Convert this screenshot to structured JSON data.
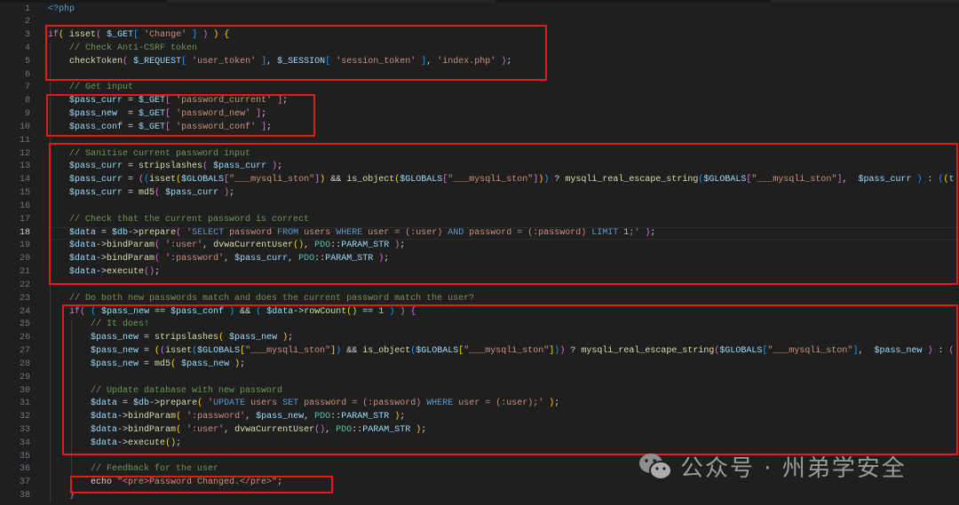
{
  "editor": {
    "current_line": 18,
    "lines": [
      [
        [
          "tag",
          "<?php"
        ]
      ],
      [],
      [
        [
          "k",
          "if"
        ],
        [
          "b1",
          "("
        ],
        [
          "p",
          " "
        ],
        [
          "f",
          "isset"
        ],
        [
          "b2",
          "("
        ],
        [
          "p",
          " "
        ],
        [
          "v",
          "$_GET"
        ],
        [
          "b3",
          "["
        ],
        [
          "p",
          " "
        ],
        [
          "s",
          "'Change'"
        ],
        [
          "p",
          " "
        ],
        [
          "b3",
          "]"
        ],
        [
          "p",
          " "
        ],
        [
          "b2",
          ")"
        ],
        [
          "p",
          " "
        ],
        [
          "b1",
          ")"
        ],
        [
          "p",
          " "
        ],
        [
          "b1",
          "{"
        ]
      ],
      [
        [
          "p",
          "    "
        ],
        [
          "c",
          "// Check Anti-CSRF token"
        ]
      ],
      [
        [
          "p",
          "    "
        ],
        [
          "f",
          "checkToken"
        ],
        [
          "b2",
          "("
        ],
        [
          "p",
          " "
        ],
        [
          "v",
          "$_REQUEST"
        ],
        [
          "b3",
          "["
        ],
        [
          "p",
          " "
        ],
        [
          "s",
          "'user_token'"
        ],
        [
          "p",
          " "
        ],
        [
          "b3",
          "]"
        ],
        [
          "p",
          ", "
        ],
        [
          "v",
          "$_SESSION"
        ],
        [
          "b3",
          "["
        ],
        [
          "p",
          " "
        ],
        [
          "s",
          "'session_token'"
        ],
        [
          "p",
          " "
        ],
        [
          "b3",
          "]"
        ],
        [
          "p",
          ", "
        ],
        [
          "s",
          "'index.php'"
        ],
        [
          "p",
          " "
        ],
        [
          "b2",
          ")"
        ],
        [
          "p",
          ";"
        ]
      ],
      [],
      [
        [
          "p",
          "    "
        ],
        [
          "c",
          "// Get input"
        ]
      ],
      [
        [
          "p",
          "    "
        ],
        [
          "v",
          "$pass_curr"
        ],
        [
          "p",
          " = "
        ],
        [
          "v",
          "$_GET"
        ],
        [
          "b2",
          "["
        ],
        [
          "p",
          " "
        ],
        [
          "s",
          "'password_current'"
        ],
        [
          "p",
          " "
        ],
        [
          "b2",
          "]"
        ],
        [
          "p",
          ";"
        ]
      ],
      [
        [
          "p",
          "    "
        ],
        [
          "v",
          "$pass_new"
        ],
        [
          "p",
          "  = "
        ],
        [
          "v",
          "$_GET"
        ],
        [
          "b2",
          "["
        ],
        [
          "p",
          " "
        ],
        [
          "s",
          "'password_new'"
        ],
        [
          "p",
          " "
        ],
        [
          "b2",
          "]"
        ],
        [
          "p",
          ";"
        ]
      ],
      [
        [
          "p",
          "    "
        ],
        [
          "v",
          "$pass_conf"
        ],
        [
          "p",
          " = "
        ],
        [
          "v",
          "$_GET"
        ],
        [
          "b2",
          "["
        ],
        [
          "p",
          " "
        ],
        [
          "s",
          "'password_conf'"
        ],
        [
          "p",
          " "
        ],
        [
          "b2",
          "]"
        ],
        [
          "p",
          ";"
        ]
      ],
      [],
      [
        [
          "p",
          "    "
        ],
        [
          "c",
          "// Sanitise current password input"
        ]
      ],
      [
        [
          "p",
          "    "
        ],
        [
          "v",
          "$pass_curr"
        ],
        [
          "p",
          " = "
        ],
        [
          "f",
          "stripslashes"
        ],
        [
          "b2",
          "("
        ],
        [
          "p",
          " "
        ],
        [
          "v",
          "$pass_curr"
        ],
        [
          "p",
          " "
        ],
        [
          "b2",
          ")"
        ],
        [
          "p",
          ";"
        ]
      ],
      [
        [
          "p",
          "    "
        ],
        [
          "v",
          "$pass_curr"
        ],
        [
          "p",
          " = "
        ],
        [
          "b2",
          "("
        ],
        [
          "b3",
          "("
        ],
        [
          "f",
          "isset"
        ],
        [
          "b1",
          "("
        ],
        [
          "v",
          "$GLOBALS"
        ],
        [
          "b2",
          "["
        ],
        [
          "s",
          "\"___mysqli_ston\""
        ],
        [
          "b2",
          "]"
        ],
        [
          "b1",
          ")"
        ],
        [
          "p",
          " && "
        ],
        [
          "f",
          "is_object"
        ],
        [
          "b1",
          "("
        ],
        [
          "v",
          "$GLOBALS"
        ],
        [
          "b2",
          "["
        ],
        [
          "s",
          "\"___mysqli_ston\""
        ],
        [
          "b2",
          "]"
        ],
        [
          "b1",
          ")"
        ],
        [
          "b3",
          ")"
        ],
        [
          "p",
          " ? "
        ],
        [
          "f",
          "mysqli_real_escape_string"
        ],
        [
          "b3",
          "("
        ],
        [
          "v",
          "$GLOBALS"
        ],
        [
          "b2",
          "["
        ],
        [
          "s",
          "\"___mysqli_ston\""
        ],
        [
          "b2",
          "]"
        ],
        [
          "p",
          ",  "
        ],
        [
          "v",
          "$pass_curr"
        ],
        [
          "p",
          " "
        ],
        [
          "b3",
          ")"
        ],
        [
          "p",
          " : "
        ],
        [
          "b3",
          "("
        ],
        [
          "b1",
          "("
        ],
        [
          "v",
          "t"
        ]
      ],
      [
        [
          "p",
          "    "
        ],
        [
          "v",
          "$pass_curr"
        ],
        [
          "p",
          " = "
        ],
        [
          "f",
          "md5"
        ],
        [
          "b2",
          "("
        ],
        [
          "p",
          " "
        ],
        [
          "v",
          "$pass_curr"
        ],
        [
          "p",
          " "
        ],
        [
          "b2",
          ")"
        ],
        [
          "p",
          ";"
        ]
      ],
      [],
      [
        [
          "p",
          "    "
        ],
        [
          "c",
          "// Check that the current password is correct"
        ]
      ],
      [
        [
          "p",
          "    "
        ],
        [
          "v",
          "$data"
        ],
        [
          "p",
          " = "
        ],
        [
          "v",
          "$db"
        ],
        [
          "p",
          "->"
        ],
        [
          "f",
          "prepare"
        ],
        [
          "b2",
          "("
        ],
        [
          "p",
          " "
        ],
        [
          "s",
          "'"
        ],
        [
          "q",
          "SELECT"
        ],
        [
          "s",
          " password "
        ],
        [
          "q",
          "FROM"
        ],
        [
          "s",
          " users "
        ],
        [
          "q",
          "WHERE"
        ],
        [
          "s",
          " user = (:user) "
        ],
        [
          "q",
          "AND"
        ],
        [
          "s",
          " password = (:password) "
        ],
        [
          "q",
          "LIMIT"
        ],
        [
          "n",
          " 1"
        ],
        [
          "s",
          ";'"
        ],
        [
          "p",
          " "
        ],
        [
          "b2",
          ")"
        ],
        [
          "p",
          ";"
        ]
      ],
      [
        [
          "p",
          "    "
        ],
        [
          "v",
          "$data"
        ],
        [
          "p",
          "->"
        ],
        [
          "f",
          "bindParam"
        ],
        [
          "b2",
          "("
        ],
        [
          "p",
          " "
        ],
        [
          "s",
          "':user'"
        ],
        [
          "p",
          ", "
        ],
        [
          "f",
          "dvwaCurrentUser"
        ],
        [
          "b1",
          "()"
        ],
        [
          "p",
          ", "
        ],
        [
          "t",
          "PDO"
        ],
        [
          "p",
          "::"
        ],
        [
          "v",
          "PARAM_STR"
        ],
        [
          "p",
          " "
        ],
        [
          "b2",
          ")"
        ],
        [
          "p",
          ";"
        ]
      ],
      [
        [
          "p",
          "    "
        ],
        [
          "v",
          "$data"
        ],
        [
          "p",
          "->"
        ],
        [
          "f",
          "bindParam"
        ],
        [
          "b2",
          "("
        ],
        [
          "p",
          " "
        ],
        [
          "s",
          "':password'"
        ],
        [
          "p",
          ", "
        ],
        [
          "v",
          "$pass_curr"
        ],
        [
          "p",
          ", "
        ],
        [
          "t",
          "PDO"
        ],
        [
          "p",
          "::"
        ],
        [
          "v",
          "PARAM_STR"
        ],
        [
          "p",
          " "
        ],
        [
          "b2",
          ")"
        ],
        [
          "p",
          ";"
        ]
      ],
      [
        [
          "p",
          "    "
        ],
        [
          "v",
          "$data"
        ],
        [
          "p",
          "->"
        ],
        [
          "f",
          "execute"
        ],
        [
          "b2",
          "()"
        ],
        [
          "p",
          ";"
        ]
      ],
      [],
      [
        [
          "p",
          "    "
        ],
        [
          "c",
          "// Do both new passwords match and does the current password match the user?"
        ]
      ],
      [
        [
          "p",
          "    "
        ],
        [
          "k",
          "if"
        ],
        [
          "b2",
          "("
        ],
        [
          "p",
          " "
        ],
        [
          "b3",
          "("
        ],
        [
          "p",
          " "
        ],
        [
          "v",
          "$pass_new"
        ],
        [
          "p",
          " == "
        ],
        [
          "v",
          "$pass_conf"
        ],
        [
          "p",
          " "
        ],
        [
          "b3",
          ")"
        ],
        [
          "p",
          " && "
        ],
        [
          "b3",
          "("
        ],
        [
          "p",
          " "
        ],
        [
          "v",
          "$data"
        ],
        [
          "p",
          "->"
        ],
        [
          "f",
          "rowCount"
        ],
        [
          "b1",
          "()"
        ],
        [
          "p",
          " == "
        ],
        [
          "n",
          "1"
        ],
        [
          "p",
          " "
        ],
        [
          "b3",
          ")"
        ],
        [
          "p",
          " "
        ],
        [
          "b2",
          ")"
        ],
        [
          "p",
          " "
        ],
        [
          "b2",
          "{"
        ]
      ],
      [
        [
          "p",
          "        "
        ],
        [
          "c",
          "// It does!"
        ]
      ],
      [
        [
          "p",
          "        "
        ],
        [
          "v",
          "$pass_new"
        ],
        [
          "p",
          " = "
        ],
        [
          "f",
          "stripslashes"
        ],
        [
          "b1",
          "("
        ],
        [
          "p",
          " "
        ],
        [
          "v",
          "$pass_new"
        ],
        [
          "p",
          " "
        ],
        [
          "b1",
          ")"
        ],
        [
          "p",
          ";"
        ]
      ],
      [
        [
          "p",
          "        "
        ],
        [
          "v",
          "$pass_new"
        ],
        [
          "p",
          " = "
        ],
        [
          "b1",
          "("
        ],
        [
          "b2",
          "("
        ],
        [
          "f",
          "isset"
        ],
        [
          "b3",
          "("
        ],
        [
          "v",
          "$GLOBALS"
        ],
        [
          "b1",
          "["
        ],
        [
          "s",
          "\"___mysqli_ston\""
        ],
        [
          "b1",
          "]"
        ],
        [
          "b3",
          ")"
        ],
        [
          "p",
          " && "
        ],
        [
          "f",
          "is_object"
        ],
        [
          "b3",
          "("
        ],
        [
          "v",
          "$GLOBALS"
        ],
        [
          "b1",
          "["
        ],
        [
          "s",
          "\"___mysqli_ston\""
        ],
        [
          "b1",
          "]"
        ],
        [
          "b3",
          ")"
        ],
        [
          "b2",
          ")"
        ],
        [
          "p",
          " ? "
        ],
        [
          "f",
          "mysqli_real_escape_string"
        ],
        [
          "b2",
          "("
        ],
        [
          "v",
          "$GLOBALS"
        ],
        [
          "b3",
          "["
        ],
        [
          "s",
          "\"___mysqli_ston\""
        ],
        [
          "b3",
          "]"
        ],
        [
          "p",
          ",  "
        ],
        [
          "v",
          "$pass_new"
        ],
        [
          "p",
          " "
        ],
        [
          "b2",
          ")"
        ],
        [
          "p",
          " : "
        ],
        [
          "b2",
          "("
        ]
      ],
      [
        [
          "p",
          "        "
        ],
        [
          "v",
          "$pass_new"
        ],
        [
          "p",
          " = "
        ],
        [
          "f",
          "md5"
        ],
        [
          "b1",
          "("
        ],
        [
          "p",
          " "
        ],
        [
          "v",
          "$pass_new"
        ],
        [
          "p",
          " "
        ],
        [
          "b1",
          ")"
        ],
        [
          "p",
          ";"
        ]
      ],
      [],
      [
        [
          "p",
          "        "
        ],
        [
          "c",
          "// Update database with new password"
        ]
      ],
      [
        [
          "p",
          "        "
        ],
        [
          "v",
          "$data"
        ],
        [
          "p",
          " = "
        ],
        [
          "v",
          "$db"
        ],
        [
          "p",
          "->"
        ],
        [
          "f",
          "prepare"
        ],
        [
          "b1",
          "("
        ],
        [
          "p",
          " "
        ],
        [
          "s",
          "'"
        ],
        [
          "q",
          "UPDATE"
        ],
        [
          "s",
          " users "
        ],
        [
          "q",
          "SET"
        ],
        [
          "s",
          " password = (:password) "
        ],
        [
          "q",
          "WHERE"
        ],
        [
          "s",
          " user = (:user);'"
        ],
        [
          "p",
          " "
        ],
        [
          "b1",
          ")"
        ],
        [
          "p",
          ";"
        ]
      ],
      [
        [
          "p",
          "        "
        ],
        [
          "v",
          "$data"
        ],
        [
          "p",
          "->"
        ],
        [
          "f",
          "bindParam"
        ],
        [
          "b1",
          "("
        ],
        [
          "p",
          " "
        ],
        [
          "s",
          "':password'"
        ],
        [
          "p",
          ", "
        ],
        [
          "v",
          "$pass_new"
        ],
        [
          "p",
          ", "
        ],
        [
          "t",
          "PDO"
        ],
        [
          "p",
          "::"
        ],
        [
          "v",
          "PARAM_STR"
        ],
        [
          "p",
          " "
        ],
        [
          "b1",
          ")"
        ],
        [
          "p",
          ";"
        ]
      ],
      [
        [
          "p",
          "        "
        ],
        [
          "v",
          "$data"
        ],
        [
          "p",
          "->"
        ],
        [
          "f",
          "bindParam"
        ],
        [
          "b1",
          "("
        ],
        [
          "p",
          " "
        ],
        [
          "s",
          "':user'"
        ],
        [
          "p",
          ", "
        ],
        [
          "f",
          "dvwaCurrentUser"
        ],
        [
          "b2",
          "()"
        ],
        [
          "p",
          ", "
        ],
        [
          "t",
          "PDO"
        ],
        [
          "p",
          "::"
        ],
        [
          "v",
          "PARAM_STR"
        ],
        [
          "p",
          " "
        ],
        [
          "b1",
          ")"
        ],
        [
          "p",
          ";"
        ]
      ],
      [
        [
          "p",
          "        "
        ],
        [
          "v",
          "$data"
        ],
        [
          "p",
          "->"
        ],
        [
          "f",
          "execute"
        ],
        [
          "b1",
          "()"
        ],
        [
          "p",
          ";"
        ]
      ],
      [],
      [
        [
          "p",
          "        "
        ],
        [
          "c",
          "// Feedback for the user"
        ]
      ],
      [
        [
          "p",
          "        "
        ],
        [
          "p",
          "echo "
        ],
        [
          "s",
          "\"<pre>Password Changed.</pre>\""
        ],
        [
          "p",
          ";"
        ]
      ],
      [
        [
          "p",
          "    "
        ],
        [
          "b2",
          "}"
        ]
      ]
    ]
  },
  "watermark": {
    "text": "公众号 · 州弟学安全",
    "icon": "wechat-icon"
  },
  "colors": {
    "highlight_box": "#e8191b",
    "background": "#1f1f1f"
  }
}
